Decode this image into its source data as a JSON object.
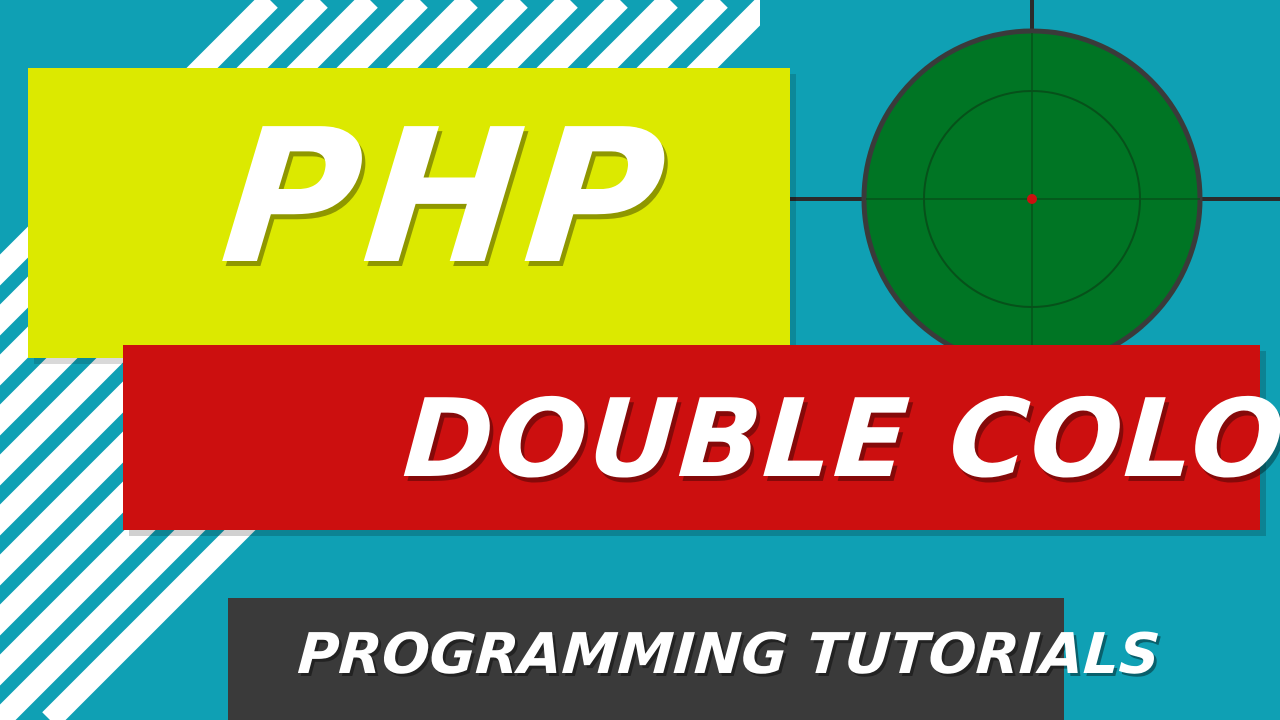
{
  "title": "PHP",
  "subtitle": "DOUBLE COLON ::",
  "footer": "PROGRAMMING TUTORIALS",
  "colors": {
    "background": "#0fa0b4",
    "title_panel": "#dce900",
    "subtitle_panel": "#cc0f0f",
    "footer_panel": "#3a3a3a",
    "target_fill": "#007524",
    "target_center": "#cc0f0f",
    "text": "#ffffff"
  },
  "icons": [
    "diagonal-stripes-decoration",
    "crosshair-target-icon"
  ]
}
